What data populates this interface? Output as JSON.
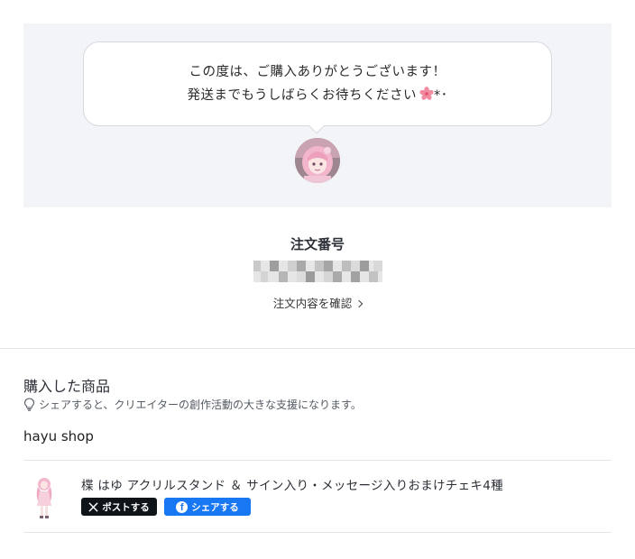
{
  "thanks": {
    "line1": "この度は、ご購入ありがとうございます！",
    "line2": "発送までもうしばらくお待ちください",
    "line2_suffix": "*･"
  },
  "order": {
    "title": "注文番号",
    "link_label": "注文内容を確認"
  },
  "purchased": {
    "title": "購入した商品",
    "note": "シェアすると、クリエイターの創作活動の大きな支援になります。",
    "shop_name": "hayu shop",
    "items": [
      {
        "name": "楪 はゆ アクリルスタンド ＆ サイン入り・メッセージ入りおまけチェキ4種",
        "share_x_label": "ポストする",
        "share_fb_label": "シェアする"
      }
    ]
  },
  "colors": {
    "panel_bg": "#f2f4f7",
    "x_button": "#0f1419",
    "facebook_button": "#1877f2"
  },
  "icons": [
    "sakura-icon",
    "lightbulb-icon",
    "x-logo-icon",
    "facebook-icon",
    "chevron-right-icon"
  ]
}
